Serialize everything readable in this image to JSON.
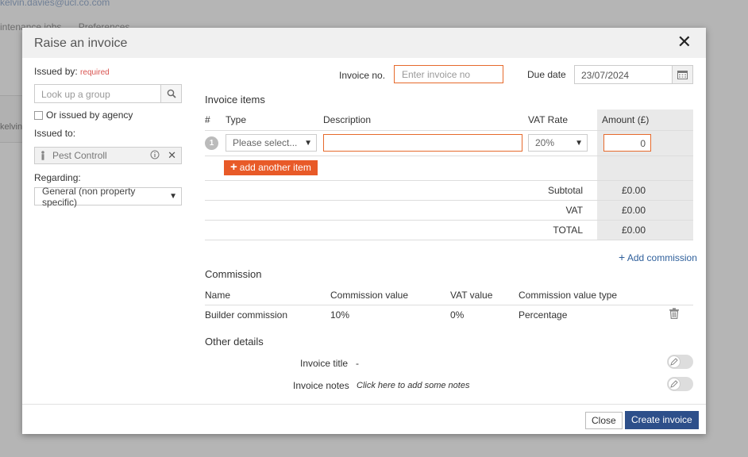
{
  "background": {
    "email": "kelvin.davies@ucl.co.com",
    "tabs": [
      "intenance jobs",
      "Preferences"
    ],
    "side_text": "kelvin."
  },
  "modal": {
    "title": "Raise an invoice",
    "close_glyph": "✕"
  },
  "left": {
    "issued_by_label": "Issued by:",
    "required_label": "required",
    "group_placeholder": "Look up a group",
    "agency_checkbox_label": "Or issued by agency",
    "issued_to_label": "Issued to:",
    "issued_to_value": "Pest Controll",
    "regarding_label": "Regarding:",
    "regarding_value": "General (non property specific)"
  },
  "invoice": {
    "number_label": "Invoice no.",
    "number_placeholder": "Enter invoice no",
    "due_date_label": "Due date",
    "due_date_value": "23/07/2024"
  },
  "items": {
    "section_title": "Invoice items",
    "headers": {
      "num": "#",
      "type": "Type",
      "description": "Description",
      "vat_rate": "VAT Rate",
      "amount": "Amount (£)"
    },
    "rows": [
      {
        "num": "1",
        "type": "Please select...",
        "description": "",
        "vat_rate": "20%",
        "amount": "0"
      }
    ],
    "add_button": "add another item",
    "subtotal_label": "Subtotal",
    "subtotal_value": "£0.00",
    "vat_label": "VAT",
    "vat_value": "£0.00",
    "total_label": "TOTAL",
    "total_value": "£0.00"
  },
  "commission": {
    "add_link": "Add commission",
    "section_title": "Commission",
    "headers": {
      "name": "Name",
      "value": "Commission value",
      "vat": "VAT value",
      "type": "Commission value type"
    },
    "rows": [
      {
        "name": "Builder commission",
        "value": "10%",
        "vat": "0%",
        "type": "Percentage"
      }
    ]
  },
  "other": {
    "section_title": "Other details",
    "title_label": "Invoice title",
    "title_value": "-",
    "notes_label": "Invoice notes",
    "notes_value": "Click here to add some notes"
  },
  "footer": {
    "close_label": "Close",
    "create_label": "Create invoice"
  },
  "colors": {
    "accent_orange": "#e85a28",
    "primary_blue": "#2d4f8a",
    "link_blue": "#2e5f9b",
    "required_red": "#d9534f"
  }
}
